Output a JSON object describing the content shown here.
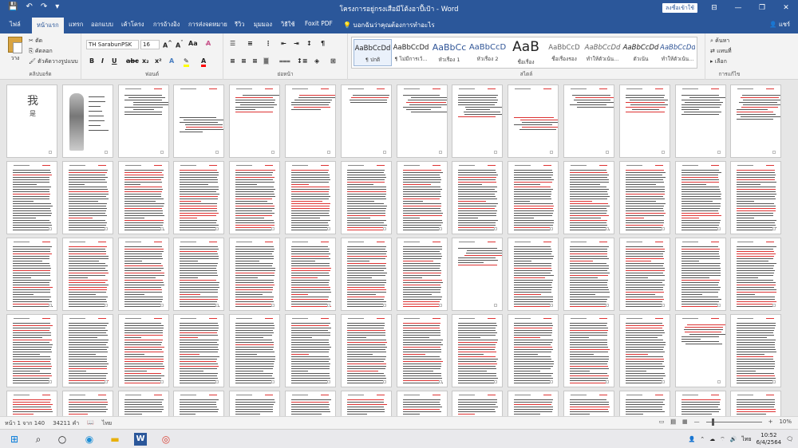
{
  "window": {
    "title": "โครงการอยู่กรงเสือมีโต้งอาปี้เป้า - Word",
    "signin_label": "ลงชื่อเข้าใช้",
    "controls": [
      "⊟",
      "—",
      "❐",
      "✕"
    ]
  },
  "quick_access": [
    "💾",
    "↶",
    "↷",
    "▾"
  ],
  "tabs": [
    "ไฟล์",
    "หน้าแรก",
    "แทรก",
    "ออกแบบ",
    "เค้าโครง",
    "การอ้างอิง",
    "การส่งจดหมาย",
    "รีวิว",
    "มุมมอง",
    "วิธีใช้",
    "Foxit PDF"
  ],
  "tell_me": "บอกฉันว่าคุณต้องการทำอะไร",
  "user": "แชร์",
  "ribbon": {
    "clipboard": {
      "paste": "วาง",
      "cut": "ตัด",
      "copy": "คัดลอก",
      "format_painter": "ตัวคัดวางรูปแบบ",
      "label": "คลิปบอร์ด"
    },
    "font": {
      "name": "TH SarabunPSK",
      "size": "16",
      "label": "ฟอนต์"
    },
    "paragraph": {
      "label": "ย่อหน้า"
    },
    "styles": {
      "label": "สไตล์",
      "items": [
        {
          "sample": "AaBbCcDd",
          "name": "¶ ปกติ"
        },
        {
          "sample": "AaBbCcDd",
          "name": "¶ ไม่มีการเว้..."
        },
        {
          "sample": "AaBbCc",
          "name": "หัวเรื่อง 1"
        },
        {
          "sample": "AaBbCcD",
          "name": "หัวเรื่อง 2"
        },
        {
          "sample": "AaB",
          "name": "ชื่อเรื่อง"
        },
        {
          "sample": "AaBbCcD",
          "name": "ชื่อเรื่องรอง"
        },
        {
          "sample": "AaBbCcDd",
          "name": "ทำให้ตัวเน้น..."
        },
        {
          "sample": "AaBbCcDd",
          "name": "ตัวเน้น"
        },
        {
          "sample": "AaBbCcDd",
          "name": "ทำให้ตัวเน้น..."
        }
      ]
    },
    "editing": {
      "find": "ค้นหา",
      "replace": "แทนที่",
      "select": "เลือก",
      "label": "การแก้ไข"
    }
  },
  "status": {
    "page": "หน้า 1 จาก 140",
    "words": "34211 คำ",
    "language": "ไทย",
    "zoom": "10%",
    "zoom_fraction": 0.1
  },
  "taskbar": {
    "time": "10:52",
    "date": "6/4/2564",
    "lang": "ไทย"
  }
}
